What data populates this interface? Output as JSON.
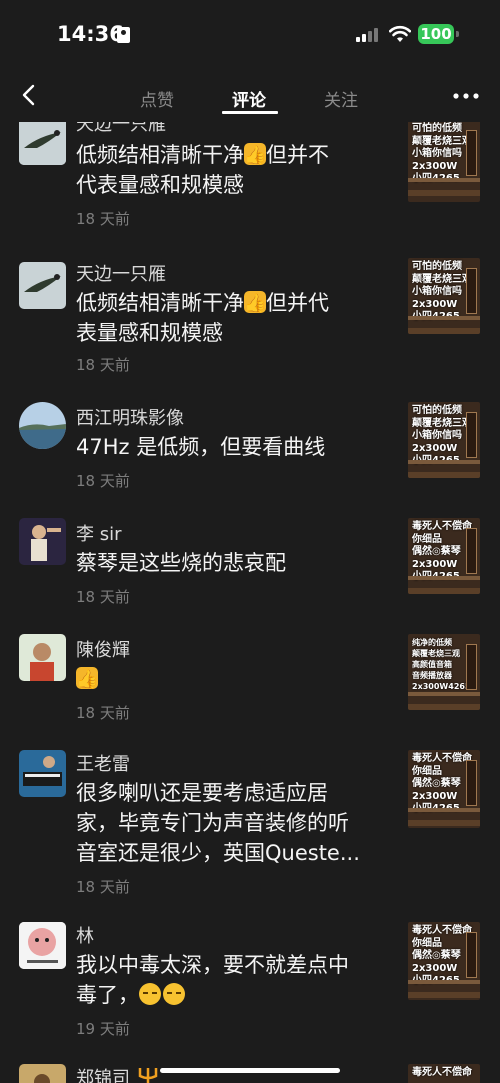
{
  "status_bar": {
    "time": "14:36",
    "battery": "100"
  },
  "nav": {
    "tabs": [
      "点赞",
      "评论",
      "关注"
    ],
    "active_tab": "评论"
  },
  "comments": [
    {
      "name": "天边一只雁",
      "text_lines": [
        "低频结相清晰干净",
        "代表量感和规模感"
      ],
      "inline_after_first": "但并不",
      "date": "18 天前",
      "thumb": "可怕的低频\n颠覆老烧三观\n小箱你信吗\n2x300W\n小四4265"
    },
    {
      "name": "天边一只雁",
      "text_lines": [
        "低频结相清晰干净",
        "表量感和规模感"
      ],
      "inline_after_first": "但并代",
      "date": "18 天前",
      "thumb": "可怕的低频\n颠覆老烧三观\n小箱你信吗\n2x300W\n小四4265"
    },
    {
      "name": "西江明珠影像",
      "text": "47Hz 是低频，但要看曲线",
      "date": "18 天前",
      "thumb": "可怕的低频\n颠覆老烧三观\n小箱你信吗\n2x300W\n小四4265"
    },
    {
      "name": "李 sir",
      "text": "蔡琴是这些烧的悲哀配",
      "date": "18 天前",
      "thumb": "毒死人不偿命\n你细品\n偶然◎蔡琴\n2x300W\n小四4265"
    },
    {
      "name": "陳俊輝",
      "text": "",
      "date": "18 天前",
      "thumb": "纯净的低频\n颠覆老烧三观\n高颜值音箱\n音频播放器\n2x300W4265"
    },
    {
      "name": "王老雷",
      "text_lines": [
        "很多喇叭还是要考虑适应居",
        "家，毕竟专门为声音装修的听",
        "音室还是很少，英国Queste..."
      ],
      "date": "18 天前",
      "thumb": "毒死人不偿命\n你细品\n偶然◎蔡琴\n2x300W\n小四4265"
    },
    {
      "name": "林",
      "text_lines": [
        "我以中毒太深，要不就差点中",
        "毒了，"
      ],
      "date": "19 天前",
      "thumb": "毒死人不偿命\n你细品\n偶然◎蔡琴\n2x300W\n小四4265"
    },
    {
      "name": "郑锦司",
      "thumb": "毒死人不偿命"
    }
  ]
}
